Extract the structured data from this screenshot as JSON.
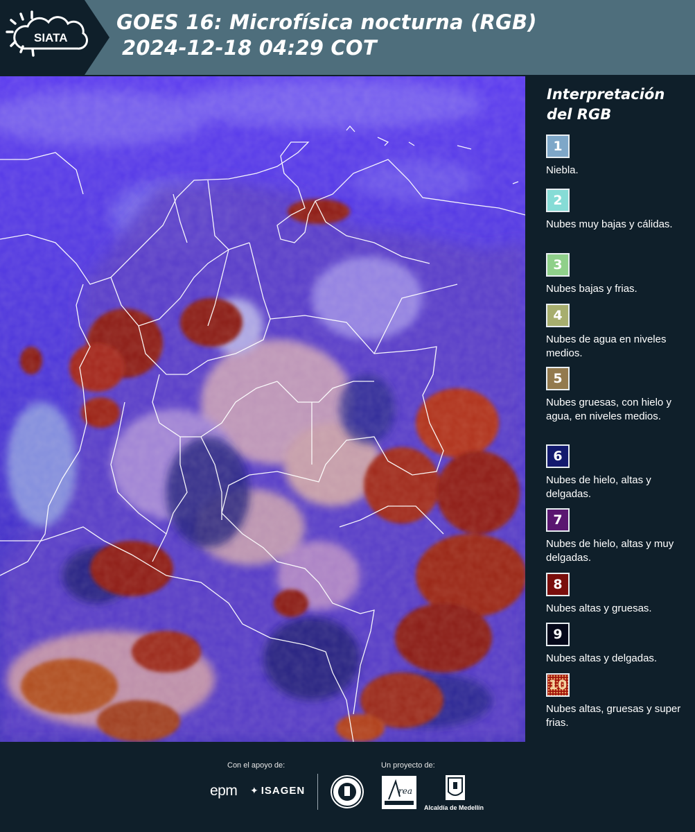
{
  "header": {
    "logo_text": "SIATA",
    "title_line1": "GOES 16: Microfísica nocturna (RGB)",
    "title_line2": "2024-12-18 04:29 COT"
  },
  "legend": {
    "title": "Interpretación del RGB",
    "items": [
      {
        "num": "1",
        "color": "#7ea7c8",
        "text_color": "#ffffff",
        "desc": "Niebla."
      },
      {
        "num": "2",
        "color": "#86dcd6",
        "text_color": "#ffffff",
        "desc": "Nubes muy bajas y cálidas."
      },
      {
        "num": "3",
        "color": "#8fd08a",
        "text_color": "#ffffff",
        "desc": "Nubes bajas y frias."
      },
      {
        "num": "4",
        "color": "#a7ae6e",
        "text_color": "#ffffff",
        "desc": "Nubes de agua en niveles medios."
      },
      {
        "num": "5",
        "color": "#937a4e",
        "text_color": "#ffffff",
        "desc": "Nubes gruesas, con hielo y agua, en niveles medios."
      },
      {
        "num": "6",
        "color": "#131a6e",
        "text_color": "#ffffff",
        "desc": "Nubes de hielo, altas y delgadas."
      },
      {
        "num": "7",
        "color": "#5a1670",
        "text_color": "#ffffff",
        "desc": "Nubes de hielo, altas y muy delgadas."
      },
      {
        "num": "8",
        "color": "#7a0e0c",
        "text_color": "#ffffff",
        "desc": "Nubes altas y gruesas."
      },
      {
        "num": "9",
        "color": "#05081a",
        "text_color": "#ffffff",
        "desc": "Nubes altas y delgadas."
      },
      {
        "num": "10",
        "color": "#a0120c",
        "text_color": "#f3d2a0",
        "desc": "Nubes altas, gruesas y super frias."
      }
    ]
  },
  "footer": {
    "support_label": "Con el apoyo de:",
    "project_label": "Un proyecto de:",
    "epm": "epm",
    "isagen": "ISAGEN",
    "alcaldia": "Alcaldía de Medellín"
  }
}
